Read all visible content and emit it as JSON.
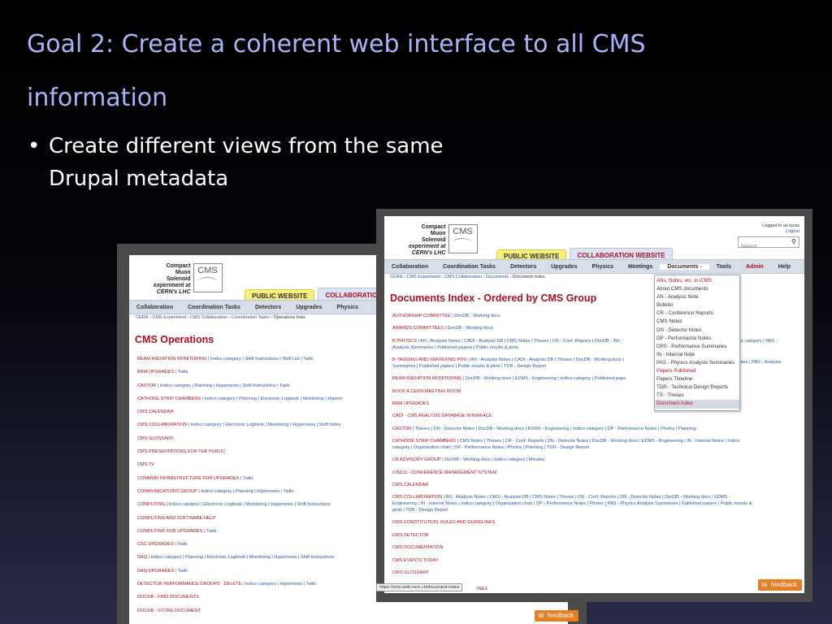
{
  "slide": {
    "title": "Goal 2:   Create a coherent web interface to all CMS information",
    "bullet_mark": "•",
    "bullet": "Create different views from the same Drupal metadata"
  },
  "logo": {
    "line1": "Compact",
    "line2": "Muon",
    "line3": "Solenoid",
    "line4": "experiment at",
    "line5": "CERN's LHC",
    "mark": "CMS"
  },
  "tabs": {
    "public": "PUBLIC WEBSITE",
    "collab": "COLLABORATION WEBSITE",
    "collab_cut": "COLLABORATION W"
  },
  "back_page": {
    "nav": [
      "Collaboration",
      "Coordination Tasks",
      "Detectors",
      "Upgrades",
      "Physics"
    ],
    "breadcrumb": [
      "CERN",
      "CMS Experiment",
      "CMS Collaboration",
      "Coordination Tasks"
    ],
    "breadcrumb_last": "Operations links",
    "heading": "CMS Operations",
    "rows": [
      {
        "group": "BEAM RADIATION MONITORING",
        "links": "Indico category | Shift Instructions | Shift List | Twiki"
      },
      {
        "group": "BRM UPGRADES",
        "links": "Twiki"
      },
      {
        "group": "CASTOR",
        "links": "Indico category | Planning | Hypernews | Shift Instructions | Twiki"
      },
      {
        "group": "CATHODE STRIP CHAMBERS",
        "links": "Indico category | Planning | Electronic Logbook | Monitoring | Hypern"
      },
      {
        "group": "CMS CALENDAR",
        "links": ""
      },
      {
        "group": "CMS COLLABORATION",
        "links": "Indico category | Electronic Logbook | Monitoring | Hypernews | Shift Instru"
      },
      {
        "group": "CMS GLOSSARY",
        "links": ""
      },
      {
        "group": "CMS PRESENTATIONS FOR THE PUBLIC",
        "links": ""
      },
      {
        "group": "CMS TV",
        "links": ""
      },
      {
        "group": "COMMON INFRASTRUCTURE FOR UPGRADES",
        "links": "Twiki"
      },
      {
        "group": "COMMUNICATIONS GROUP",
        "links": "Indico category | Planning | Hypernews | Twiki"
      },
      {
        "group": "COMPUTING",
        "links": "Indico category | Electronic Logbook | Monitoring | Hypernews | Shift Instructions"
      },
      {
        "group": "COMPUTING AND SOFTWARE HELP",
        "links": ""
      },
      {
        "group": "COMPUTING FOR UPGRADES",
        "links": "Twiki"
      },
      {
        "group": "CSC UPGRADES",
        "links": "Twiki"
      },
      {
        "group": "DAQ",
        "links": "Indico category | Planning | Electronic Logbook | Monitoring | Hypernews | Shift Instructions"
      },
      {
        "group": "DAQ UPGRADES",
        "links": "Twiki"
      },
      {
        "group": "DETECTOR PERFORMANCE GROUPS - DELETE",
        "links": "Indico category | Hypernews | Twiki"
      },
      {
        "group": "DOCDB - FIND DOCUMENTS",
        "links": ""
      },
      {
        "group": "DOCDB - STORE DOCUMENT",
        "links": ""
      }
    ],
    "feedback": "feedback"
  },
  "front_page": {
    "login_text": "Logged in as lucas",
    "logout": "Logout",
    "search_placeholder": "Search",
    "nav": [
      "Collaboration",
      "Coordination Tasks",
      "Detectors",
      "Upgrades",
      "Physics",
      "Meetings",
      "Documents -",
      "Tools",
      "Admin",
      "Help"
    ],
    "breadcrumb": [
      "CERN",
      "CMS Experiment",
      "CMS Collaboration",
      "Documents"
    ],
    "breadcrumb_last": "Document index",
    "heading": "Documents Index - Ordered by CMS Group",
    "rows": [
      {
        "group": "AUTHORSHIP COMMITTEE",
        "links": "DocDB - Working docs"
      },
      {
        "group": "AWARDS COMMITTEES",
        "links": "DocDB - Working docs"
      },
      {
        "group": "B PHYSICS",
        "links": "AN - Analysis Notes | CADI - Analysis DB | CMS Notes | Theses | CR - Conf. Reports | DocDB - Wo",
        "links2": "Analysis Summaries | Published papers | Public results & plots"
      },
      {
        "group": "B-TAGGING AND VERTEXING POG",
        "links": "AN - Analysis Notes | CADI - Analysis DB | Theses | DocDB - Working docs |",
        "links2": "Summaries | Published papers | Public results & plots | TDR - Design Report"
      },
      {
        "group": "BEAM RADIATION MONITORING",
        "links": "DocDB - Working docs | EDMS - Engineering | Indico category | Published pape"
      },
      {
        "group": "BOOK A CERN MEETING ROOM",
        "links": ""
      },
      {
        "group": "BRM UPGRADES",
        "links": ""
      },
      {
        "group": "CADI - CMS ANALYSIS DATABASE INTERFACE",
        "links": ""
      },
      {
        "group": "CASTOR",
        "links": "Theses | DN - Detector Notes | DocDB - Working docs | EDMS - Engineering | Indico category | DP - Performance Notes | Photos | Planning"
      },
      {
        "group": "CATHODE STRIP CHAMBERS",
        "links": "CMS Notes | Theses | CR - Conf. Reports | DN - Detector Notes | DocDB - Working docs | EDMS - Engineering | IN - Internal Notes | Indico",
        "links2": "category | Organization chart | DP - Performance Notes | Photos | Planning | TDR - Design Report"
      },
      {
        "group": "CB ADVISORY GROUP",
        "links": "DocDB - Working docs | Indico category | Minutes"
      },
      {
        "group": "CINCO - CONFERENCE MANAGEMENT SYSTEM",
        "links": ""
      },
      {
        "group": "CMS CALENDAR",
        "links": ""
      },
      {
        "group": "CMS COLLABORATION",
        "links": "AN - Analysis Notes | CADI - Analysis DB | CMS Notes | Theses | CR - Conf. Reports | DN - Detector Notes | DocDB - Working docs | EDMS -",
        "links2": "Engineering | IN - Internal Notes | Indico category | Organization chart | DP - Performance Notes | Photos | PAS - Physics Analysis Summaries | Published papers | Public results &",
        "links3": "plots | TDR - Design Report"
      },
      {
        "group": "CMS CONSTITUTION, RULES AND GUIDELINES",
        "links": ""
      },
      {
        "group": "CMS DETECTOR",
        "links": ""
      },
      {
        "group": "CMS DOCUMENTATION",
        "links": ""
      },
      {
        "group": "CMS EVENTS TODAY",
        "links": ""
      },
      {
        "group": "CMS GLOSSARY",
        "links": ""
      }
    ],
    "dropdown": [
      {
        "label": "ANs, Notes, etc. in iCMS",
        "style": "red"
      },
      {
        "label": "About CMS documents",
        "style": ""
      },
      {
        "label": "AN - Analysis Note",
        "style": ""
      },
      {
        "label": "Bulletin",
        "style": ""
      },
      {
        "label": "CR - Conference Reports",
        "style": ""
      },
      {
        "label": "CMS Notes",
        "style": ""
      },
      {
        "label": "DN - Detector Notes",
        "style": ""
      },
      {
        "label": "DP - Performance Notes",
        "style": ""
      },
      {
        "label": "DPS - Performance Summaries",
        "style": ""
      },
      {
        "label": "IN - Internal Note",
        "style": ""
      },
      {
        "label": "PAS - Physics Analysis Summaries",
        "style": ""
      },
      {
        "label": "Papers Published",
        "style": "red"
      },
      {
        "label": "Papers Timeline",
        "style": ""
      },
      {
        "label": "TDR - Technical Design Reports",
        "style": ""
      },
      {
        "label": "TS - Theses",
        "style": ""
      },
      {
        "label": "Document index",
        "style": "sel"
      }
    ],
    "overflow_right": [
      {
        "text": "to category | PAS -"
      },
      {
        "text": "otes | PAS - Analysis"
      }
    ],
    "partial_row": "INES",
    "status_url": "https://cms.web.cern.ch/document-index",
    "feedback": "feedback"
  }
}
